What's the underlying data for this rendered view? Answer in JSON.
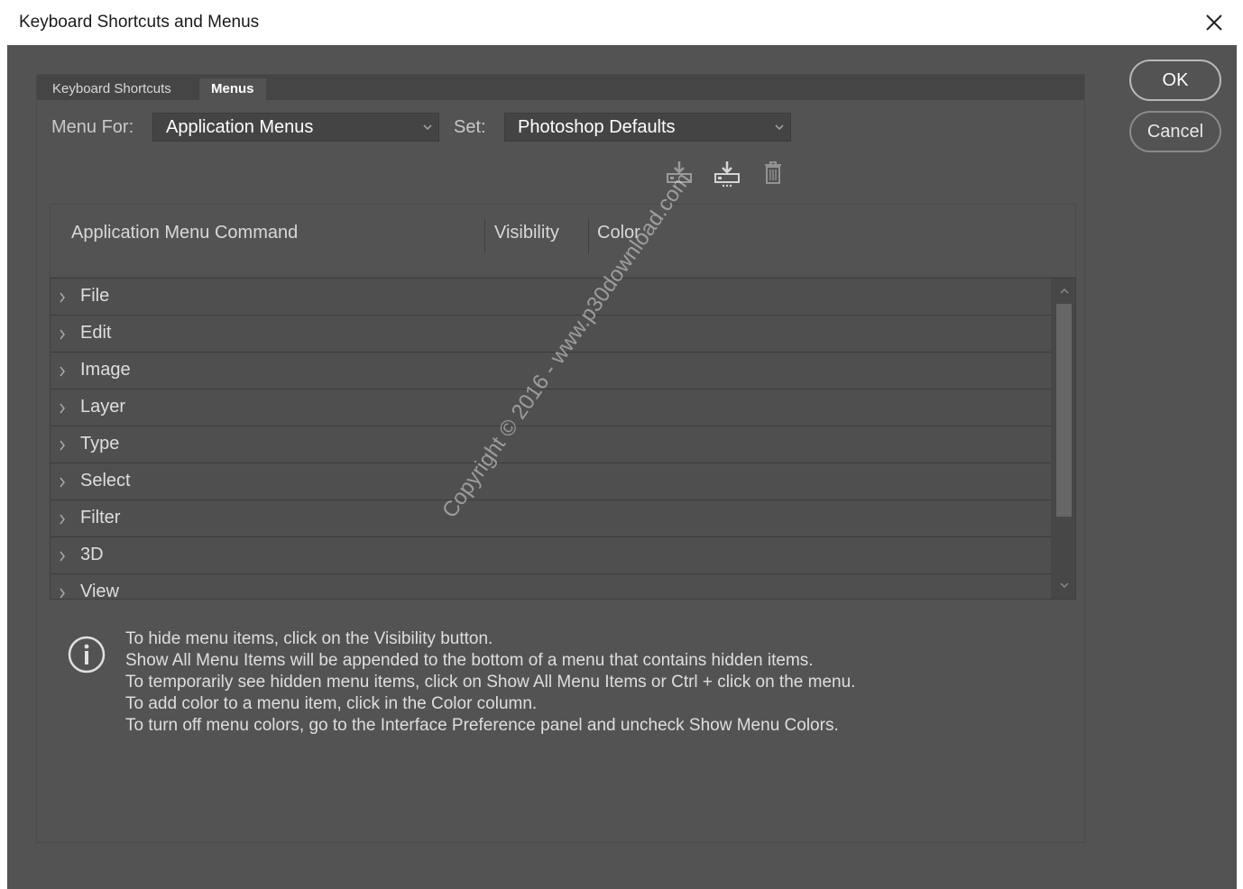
{
  "window": {
    "title": "Keyboard Shortcuts and Menus"
  },
  "tabs": [
    {
      "label": "Keyboard Shortcuts",
      "active": false
    },
    {
      "label": "Menus",
      "active": true
    }
  ],
  "controls": {
    "menu_for_label": "Menu For:",
    "menu_for_value": "Application Menus",
    "set_label": "Set:",
    "set_value": "Photoshop Defaults"
  },
  "set_actions": {
    "icons": [
      "save-set-icon",
      "save-set-as-icon",
      "delete-set-icon"
    ]
  },
  "table": {
    "columns": [
      "Application Menu Command",
      "Visibility",
      "Color"
    ],
    "rows": [
      {
        "label": "File"
      },
      {
        "label": "Edit"
      },
      {
        "label": "Image"
      },
      {
        "label": "Layer"
      },
      {
        "label": "Type"
      },
      {
        "label": "Select"
      },
      {
        "label": "Filter"
      },
      {
        "label": "3D"
      },
      {
        "label": "View"
      }
    ]
  },
  "info": {
    "lines": [
      "To hide menu items, click on the Visibility button.",
      "Show All Menu Items will be appended to the bottom of a menu that contains hidden items.",
      "To temporarily see hidden menu items, click on Show All Menu Items or Ctrl + click on the menu.",
      "To add color to a menu item, click in the Color column.",
      "To turn off menu colors, go to the Interface Preference panel and uncheck Show Menu Colors."
    ]
  },
  "buttons": {
    "ok": "OK",
    "cancel": "Cancel"
  },
  "watermark": "Copyright © 2016 - www.p30download.com",
  "colors": {
    "dialog_bg": "#535353",
    "field_bg": "#444444",
    "list_bg": "#474747",
    "text": "#dedede"
  }
}
